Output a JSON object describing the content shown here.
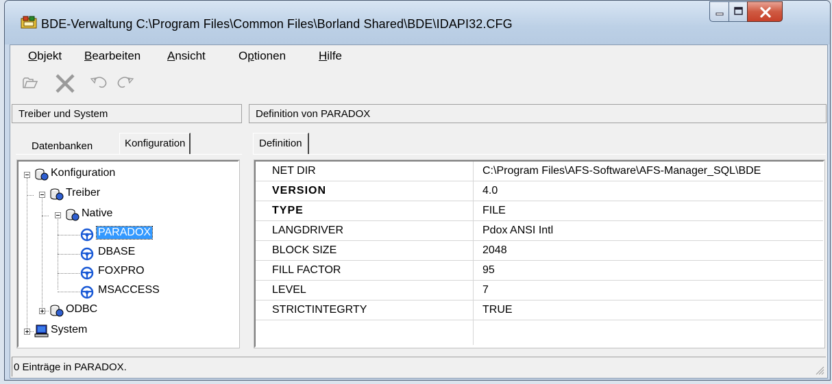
{
  "window": {
    "title": "BDE-Verwaltung  C:\\Program Files\\Common Files\\Borland Shared\\BDE\\IDAPI32.CFG"
  },
  "menu": [
    {
      "label": "Objekt",
      "accel": "O",
      "rest": "bjekt"
    },
    {
      "label": "Bearbeiten",
      "accel": "B",
      "rest": "earbeiten"
    },
    {
      "label": "Ansicht",
      "accel": "A",
      "rest": "nsicht"
    },
    {
      "label": "Optionen",
      "pre": "O",
      "accel": "p",
      "rest": "tionen"
    },
    {
      "label": "Hilfe",
      "accel": "H",
      "rest": "ilfe"
    }
  ],
  "left_panel": {
    "header": "Treiber und System",
    "tabs": [
      "Datenbanken",
      "Konfiguration"
    ],
    "active_tab": "Konfiguration",
    "tree": {
      "root": "Konfiguration",
      "treiber": "Treiber",
      "native": "Native",
      "drivers": [
        "PARADOX",
        "DBASE",
        "FOXPRO",
        "MSACCESS"
      ],
      "selected": "PARADOX",
      "odbc": "ODBC",
      "system": "System"
    }
  },
  "right_panel": {
    "header": "Definition von PARADOX",
    "tab": "Definition",
    "rows": [
      {
        "name": "NET DIR",
        "value": "C:\\Program Files\\AFS-Software\\AFS-Manager_SQL\\BDE",
        "bold": false
      },
      {
        "name": "VERSION",
        "value": "4.0",
        "bold": true
      },
      {
        "name": "TYPE",
        "value": "FILE",
        "bold": true
      },
      {
        "name": "LANGDRIVER",
        "value": "Pdox ANSI Intl",
        "bold": false
      },
      {
        "name": "BLOCK SIZE",
        "value": "2048",
        "bold": false
      },
      {
        "name": "FILL FACTOR",
        "value": "95",
        "bold": false
      },
      {
        "name": "LEVEL",
        "value": "7",
        "bold": false
      },
      {
        "name": "STRICTINTEGRTY",
        "value": "TRUE",
        "bold": false
      }
    ]
  },
  "status": {
    "text": "0 Einträge in PARADOX."
  },
  "colors": {
    "selection": "#3399ff",
    "driver_icon": "#1a5ad6"
  }
}
